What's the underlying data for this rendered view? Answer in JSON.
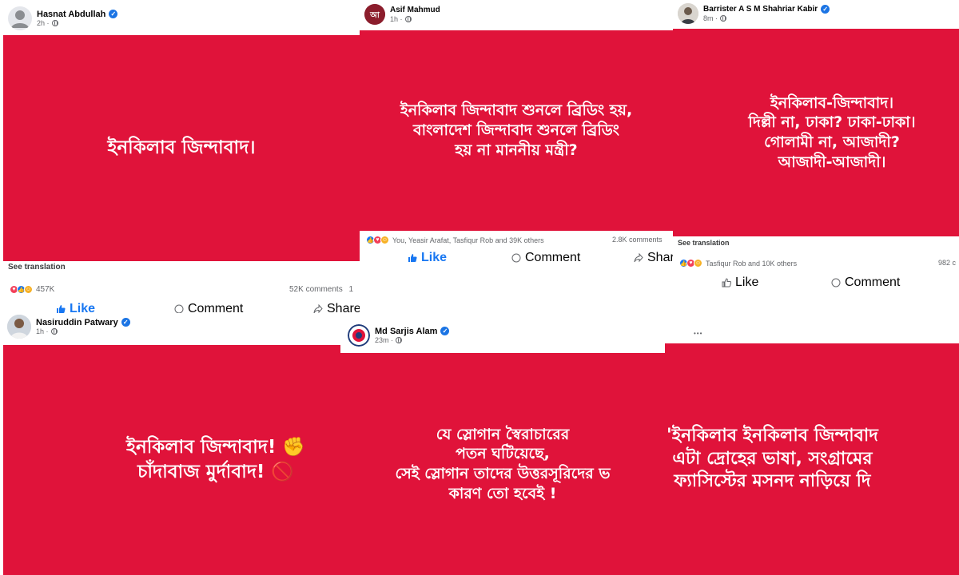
{
  "posts": {
    "hasnat": {
      "author": "Hasnat Abdullah",
      "time": "2h ·",
      "card_text": "ইনকিলাব জিন্দাবাদ।",
      "see_translation": "See translation",
      "reaction_count": "457K",
      "comments": "52K comments",
      "comments_suffix": "1",
      "like_label": "Like",
      "comment_label": "Comment",
      "share_label": "Share"
    },
    "asif": {
      "author": "Asif Mahmud",
      "time": "1h ·",
      "card_text": "ইনকিলাব জিন্দাবাদ শুনলে ব্রিডিং হয়,\nবাংলাদেশ জিন্দাবাদ শুনলে ব্রিডিং\nহয় না মাননীয় মন্ত্রী?",
      "reaction_text": "You, Yeasir Arafat, Tasfiqur Rob and 39K others",
      "comments": "2.8K comments",
      "like_label": "Like",
      "comment_label": "Comment",
      "share_label": "Share"
    },
    "barrister": {
      "author": "Barrister A S M Shahriar Kabir",
      "time": "8m ·",
      "card_text": "ইনকিলাব-জিন্দাবাদ।\nদিল্লী না, ঢাকা? ঢাকা-ঢাকা।\nগোলামী না, আজাদী?\nআজাদী-আজাদী।",
      "see_translation": "See translation",
      "reaction_text": "Tasfiqur Rob and 10K others",
      "comments": "982 c",
      "like_label": "Like",
      "comment_label": "Comment",
      "more": "•••"
    },
    "nasiruddin": {
      "author": "Nasiruddin Patwary",
      "time": "1h ·",
      "card_line1": "ইনকিলাব জিন্দাবাদ! ✊",
      "card_line2": "চাঁদাবাজ মুর্দাবাদ! 🚫"
    },
    "sarjis": {
      "author": "Md Sarjis Alam",
      "time": "23m ·",
      "card_text": "যে স্লোগান স্বৈরাচারের\nপতন ঘটিয়েছে,\nসেই স্লোগান তাদের উত্তরসূরিদের ভ\nকারণ তো হবেই !"
    },
    "last": {
      "card_text": "'ইনকিলাব ইনকিলাব জিন্দাবাদ\nএটা দ্রোহের ভাষা, সংগ্রামের\nফ্যাসিস্টের মসনদ নাড়িয়ে দি"
    }
  },
  "colors": {
    "card_red": "#e0133a",
    "like_blue": "#1877f2",
    "verified_blue": "#1b74e4",
    "meta_gray": "#65676b"
  },
  "icons": [
    "verified-badge-icon",
    "globe-icon",
    "like-icon",
    "comment-icon",
    "share-icon",
    "like-reaction-icon",
    "love-reaction-icon",
    "haha-reaction-icon"
  ]
}
